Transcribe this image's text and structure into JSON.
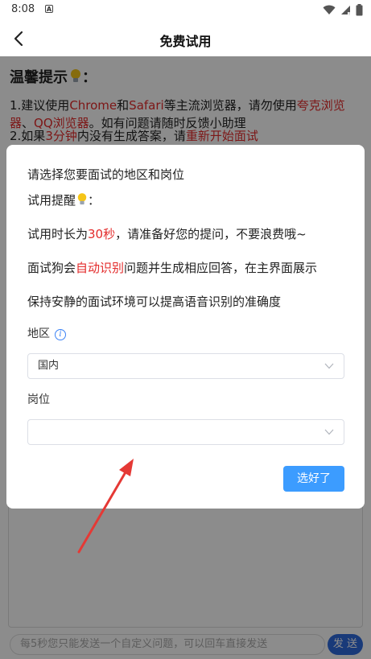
{
  "status_bar": {
    "time": "8:08",
    "notification_glyph": "A"
  },
  "nav": {
    "title": "免费试用"
  },
  "tips": {
    "heading": "温馨提示",
    "line1": {
      "p1": "1.建议使用",
      "chrome": "Chrome",
      "p2": "和",
      "safari": "Safari",
      "p3": "等主流浏览器，请勿使用",
      "quark": "夸克浏览器",
      "p4": "、",
      "qq": "QQ浏览器",
      "p5": "。如有问题请随时反馈小助理"
    },
    "line2": {
      "p1": "2.如果",
      "minutes": "3分钟",
      "p2": "内没有生成答案，请",
      "restart": "重新开始面试"
    }
  },
  "bottom": {
    "input_placeholder": "每5秒您只能发送一个自定义问题，可以回车直接发送",
    "send_label": "发 送"
  },
  "dialog": {
    "title": "请选择您要面试的地区和岗位",
    "hint_label": "试用提醒",
    "line1": {
      "p1": "试用时长为",
      "secs": "30秒",
      "p2": "，请准备好您的提问，不要浪费哦~"
    },
    "line2": {
      "p1": "面试狗会",
      "auto": "自动识别",
      "p2": "问题并生成相应回答，在主界面展示"
    },
    "line3": "保持安静的面试环境可以提高语音识别的准确度",
    "region_label": "地区",
    "region_value": "国内",
    "position_label": "岗位",
    "position_value": "",
    "confirm_label": "选好了"
  },
  "colors": {
    "accent": "#3c9cff",
    "highlight_red": "#e32b2b",
    "send_blue": "#2f6bdc"
  }
}
